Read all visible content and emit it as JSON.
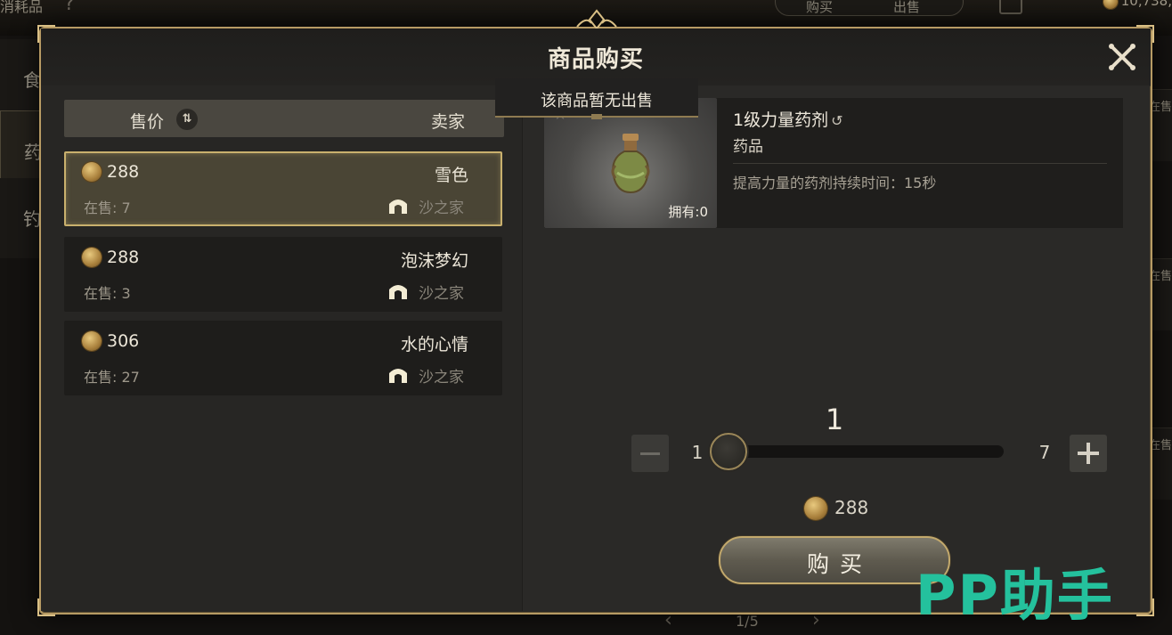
{
  "background": {
    "top_left_label": "消耗品",
    "help_icon": "?",
    "tabs": {
      "buy": "购买",
      "sell": "出售"
    },
    "wallet": "10,738,",
    "left_categories": [
      "食",
      "药",
      "钓"
    ],
    "right_items": [
      "在售",
      "在售",
      "在售"
    ],
    "pager": "1/5"
  },
  "modal": {
    "title": "商品购买",
    "tooltip": "该商品暂无出售",
    "sort_header": {
      "price_label": "售价",
      "sort_icon": "⇅",
      "seller_label": "卖家"
    },
    "listings": [
      {
        "price": "288",
        "seller": "雪色",
        "stock": "在售: 7",
        "guild": "沙之家",
        "selected": true
      },
      {
        "price": "288",
        "seller": "泡沫梦幻",
        "stock": "在售: 3",
        "guild": "沙之家",
        "selected": false
      },
      {
        "price": "306",
        "seller": "水的心情",
        "stock": "在售: 27",
        "guild": "沙之家",
        "selected": false
      }
    ],
    "item": {
      "name": "1级力量药剂",
      "bind_icon": "bind-icon",
      "category": "药品",
      "description": "提高力量的药剂持续时间：15秒",
      "owned": "拥有:0"
    },
    "quantity": {
      "value": "1",
      "min": "1",
      "max": "7"
    },
    "total_price": "288",
    "buy_label": "购买"
  },
  "watermark": "PP助手",
  "colors": {
    "accent_gold": "#c9b06d",
    "watermark_green": "#24c19d"
  }
}
